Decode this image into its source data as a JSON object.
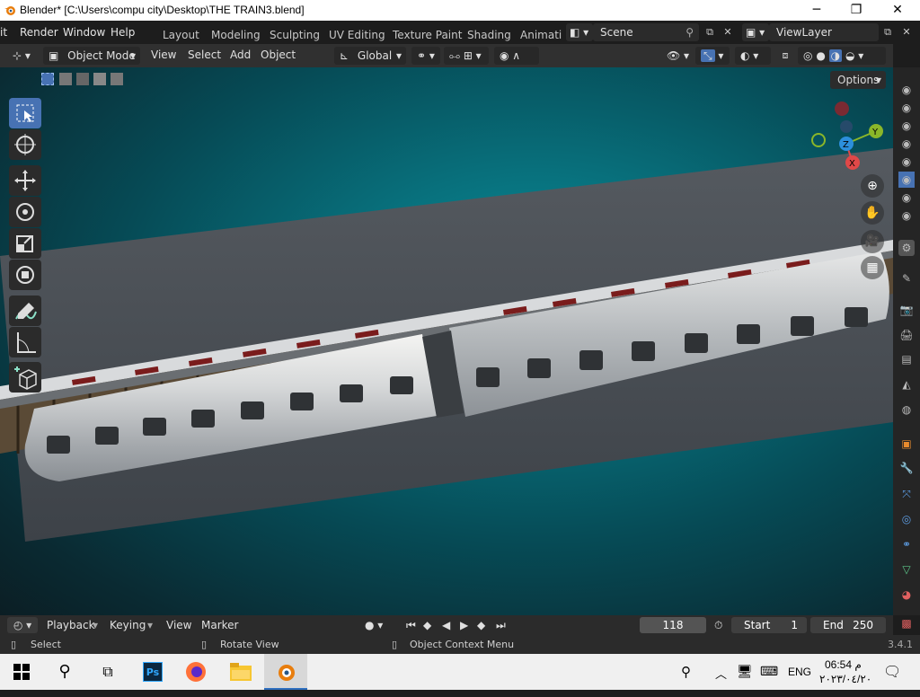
{
  "window": {
    "title": "Blender* [C:\\Users\\compu city\\Desktop\\THE TRAIN3.blend]",
    "min": "─",
    "max": "❐",
    "close": "✕"
  },
  "menu": {
    "items": [
      "it",
      "Render",
      "Window",
      "Help"
    ],
    "workspaces": [
      "Layout",
      "Modeling",
      "Sculpting",
      "UV Editing",
      "Texture Paint",
      "Shading",
      "Animati"
    ],
    "scene": "Scene",
    "view_layer": "ViewLayer"
  },
  "viewport_header": {
    "mode": "Object Mode",
    "menus": [
      "View",
      "Select",
      "Add",
      "Object"
    ],
    "orientation": "Global",
    "options": "Options"
  },
  "gizmo": {
    "x": "X",
    "y": "Y",
    "z": "Z"
  },
  "timeline": {
    "menus": [
      "Playback",
      "Keying",
      "View",
      "Marker"
    ],
    "current_frame": "118",
    "start_label": "Start",
    "start": "1",
    "end_label": "End",
    "end": "250"
  },
  "status": {
    "select": "Select",
    "rotate": "Rotate View",
    "context": "Object Context Menu",
    "version": "3.4.1"
  },
  "taskbar": {
    "lang": "ENG",
    "time": "06:54 م",
    "date": "٢٠٢٣/٠٤/٢٠"
  },
  "colors": {
    "accent": "#4772b3",
    "viewport_teal": "#0a8d99",
    "axis_x": "#e04848",
    "axis_y": "#8ab629",
    "axis_z": "#2c8fdc"
  }
}
